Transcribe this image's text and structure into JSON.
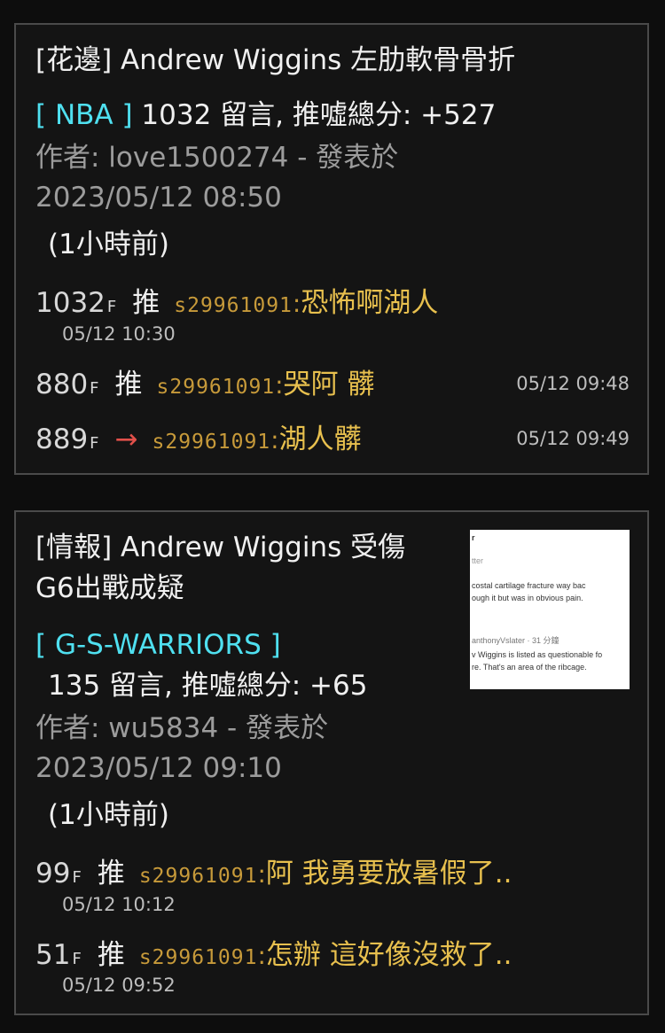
{
  "posts": [
    {
      "title": "[花邊] Andrew Wiggins 左肋軟骨骨折",
      "board": "[ NBA ]",
      "stats": "1032 留言, 推噓總分: +527",
      "author_line": "作者: love1500274 - 發表於",
      "date": "2023/05/12 08:50",
      "ago": "(1小時前)",
      "pushes": [
        {
          "floor": "1032",
          "floor_suffix": "F",
          "type": "推",
          "user": "s29961091",
          "colon": ":",
          "text": "恐怖啊湖人",
          "time": "05/12 10:30"
        },
        {
          "floor": "880",
          "floor_suffix": "F",
          "type": "推",
          "user": "s29961091",
          "colon": ":",
          "text": "哭阿 髒",
          "time": "05/12 09:48"
        },
        {
          "floor": "889",
          "floor_suffix": "F",
          "type": "→",
          "user": "s29961091",
          "colon": ":",
          "text": "湖人髒",
          "time": "05/12 09:49"
        }
      ]
    },
    {
      "title_line1": "[情報] Andrew Wiggins 受傷",
      "title_line2": "G6出戰成疑",
      "board": "[ G-S-WARRIORS ]",
      "stats": "135 留言, 推噓總分: +65",
      "author_line": "作者: wu5834 - 發表於",
      "date": "2023/05/12 09:10",
      "ago": "(1小時前)",
      "thumbnail": {
        "lines": [
          "r",
          "tter",
          "costal cartilage fracture way bac",
          "ough it but was in obvious pain.",
          "anthonyVslater · 31 分鐘",
          "v Wiggins is listed as questionable fo",
          "re. That's an area of the ribcage."
        ]
      },
      "pushes": [
        {
          "floor": "99",
          "floor_suffix": "F",
          "type": "推",
          "user": "s29961091",
          "colon": ":",
          "text": "阿 我勇要放暑假了..",
          "time": "05/12 10:12"
        },
        {
          "floor": "51",
          "floor_suffix": "F",
          "type": "推",
          "user": "s29961091",
          "colon": ":",
          "text": "怎辦 這好像沒救了..",
          "time": "05/12 09:52"
        }
      ]
    }
  ]
}
